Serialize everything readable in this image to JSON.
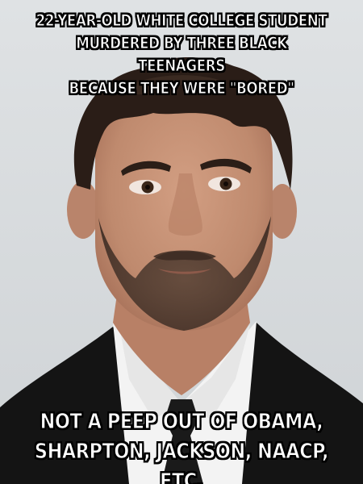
{
  "meme": {
    "top_text": "22-YEAR-OLD WHITE COLLEGE STUDENT\nMURDERED BY THREE BLACK TEENAGERS\nBECAUSE THEY WERE \"BORED\"",
    "bottom_text": "NOT A PEEP OUT OF OBAMA,\nSHARPTON, JACKSON, NAACP, ETC."
  },
  "colors": {
    "background": "#dcdfe1",
    "caption_fill": "#ffffff",
    "caption_outline": "#000000",
    "suit": "#151515",
    "shirt": "#f4f4f4",
    "hair": "#2a1d17",
    "skin": "#c48f74"
  }
}
